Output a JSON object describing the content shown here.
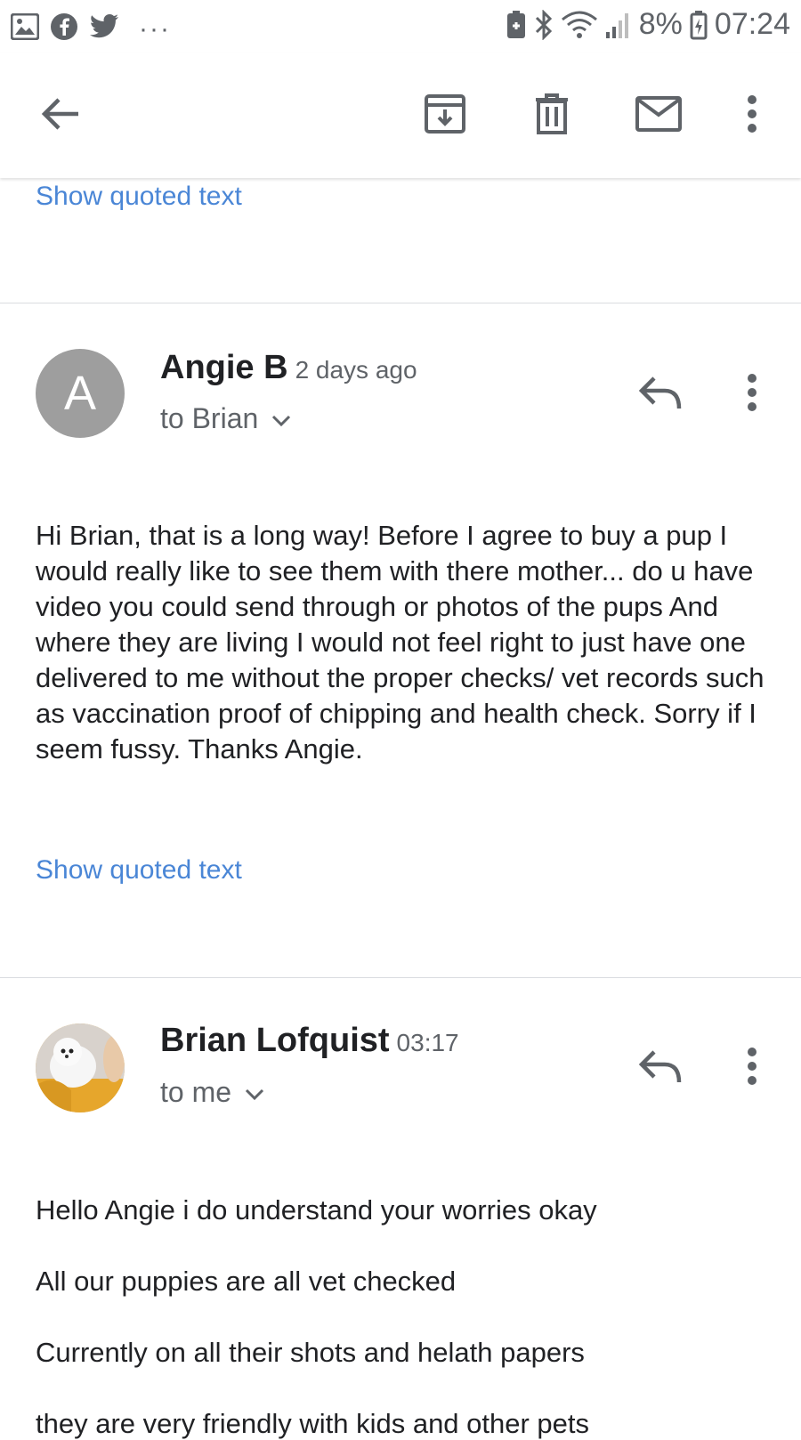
{
  "status_bar": {
    "left_icons": [
      "image-icon",
      "facebook-icon",
      "twitter-icon",
      "more-notifications-icon"
    ],
    "more": "···",
    "battery_percent": "8%",
    "time": "07:24"
  },
  "toolbar": {
    "icons": [
      "back-arrow-icon",
      "archive-icon",
      "delete-icon",
      "mark-unread-icon",
      "overflow-menu-icon"
    ]
  },
  "thread": {
    "top_quoted_link": "Show quoted text",
    "messages": [
      {
        "avatar_letter": "A",
        "sender": "Angie B",
        "time": "2 days ago",
        "recipient": "to Brian",
        "body": "Hi Brian, that is a long way! Before I agree to buy a pup I would really like to see them with there mother... do u have video you could send through or photos of the pups And where they are living I would not feel right to just have one delivered to me without the proper checks/ vet records such as vaccination proof of chipping and health check. Sorry if I seem fussy. Thanks Angie.",
        "quoted_link": "Show quoted text"
      },
      {
        "sender": "Brian Lofquist",
        "time": "03:17",
        "recipient": "to me",
        "paragraphs": [
          "Hello Angie i do understand your worries okay",
          "All our puppies are all vet checked",
          "Currently on all their shots and helath papers",
          "they are very friendly with kids and other pets"
        ]
      }
    ]
  },
  "colors": {
    "link": "#4a86d6",
    "avatar_grey": "#9e9e9e",
    "icon_grey": "#5f6368"
  }
}
